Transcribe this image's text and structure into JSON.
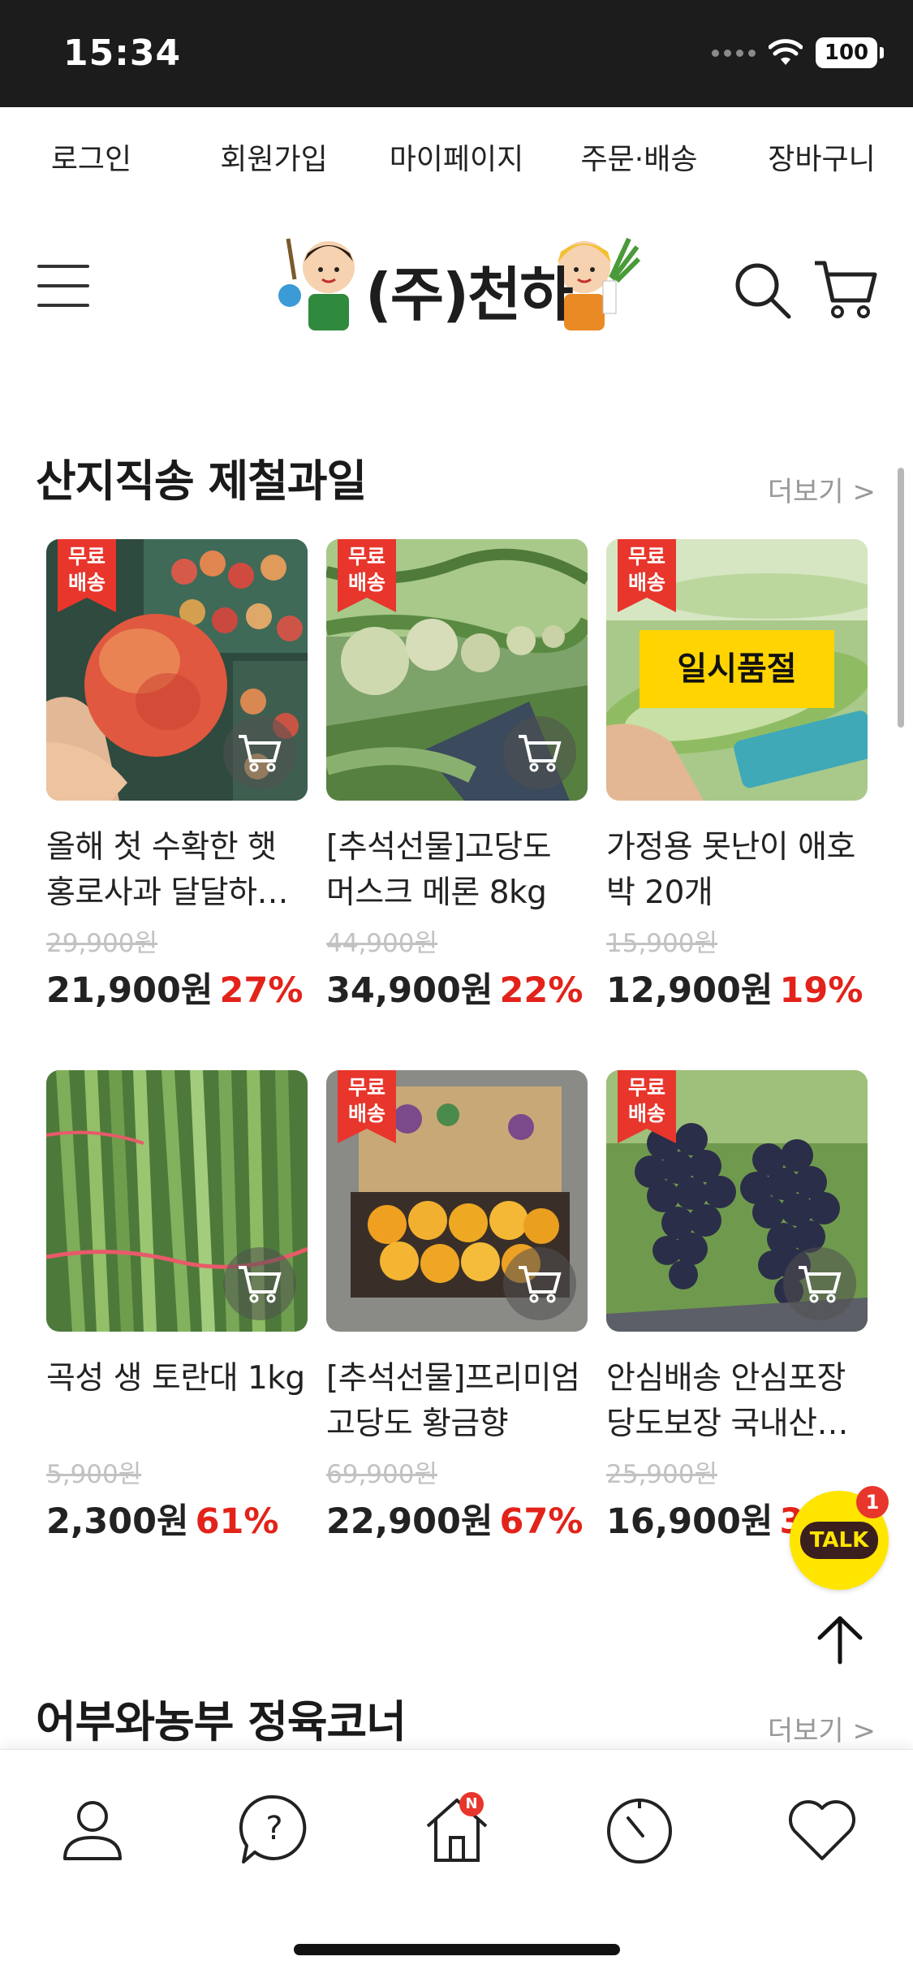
{
  "status_bar": {
    "time": "15:34",
    "battery": "100"
  },
  "top_links": [
    "로그인",
    "회원가입",
    "마이페이지",
    "주문·배송",
    "장바구니"
  ],
  "header": {
    "logo_text": "(주)천하"
  },
  "section1": {
    "title": "산지직송 제철과일",
    "more": "더보기 >",
    "products": [
      {
        "name": "올해 첫 수확한 햇 홍로사과 달달하…",
        "orig_price": "29,900원",
        "price": "21,900원",
        "discount": "27%",
        "free_badge": "무료\n배송",
        "sold_out": "",
        "image": "apple"
      },
      {
        "name": "[추석선물]고당도 머스크 메론 8kg",
        "orig_price": "44,900원",
        "price": "34,900원",
        "discount": "22%",
        "free_badge": "무료\n배송",
        "sold_out": "",
        "image": "melon"
      },
      {
        "name": "가정용 못난이 애호박 20개",
        "orig_price": "15,900원",
        "price": "12,900원",
        "discount": "19%",
        "free_badge": "무료\n배송",
        "sold_out": "일시품절",
        "image": "zucchini"
      },
      {
        "name": "곡성 생 토란대 1kg",
        "orig_price": "5,900원",
        "price": "2,300원",
        "discount": "61%",
        "free_badge": "",
        "sold_out": "",
        "image": "taro-stem"
      },
      {
        "name": "[추석선물]프리미엄 고당도 황금향",
        "orig_price": "69,900원",
        "price": "22,900원",
        "discount": "67%",
        "free_badge": "무료\n배송",
        "sold_out": "",
        "image": "citrus-box"
      },
      {
        "name": "안심배송 안심포장 당도보장 국내산…",
        "orig_price": "25,900원",
        "price": "16,900원",
        "discount": "35%",
        "free_badge": "무료\n배송",
        "sold_out": "",
        "image": "grapes"
      }
    ]
  },
  "section2": {
    "title": "어부와농부 정육코너",
    "more": "더보기 >"
  },
  "floating": {
    "talk_label": "TALK",
    "talk_count": "1"
  },
  "bottom_nav": {
    "home_badge": "N"
  },
  "colors": {
    "discount": "#e2231a",
    "badge": "#e8362c",
    "soldout": "#ffd400",
    "talk": "#ffe500"
  }
}
